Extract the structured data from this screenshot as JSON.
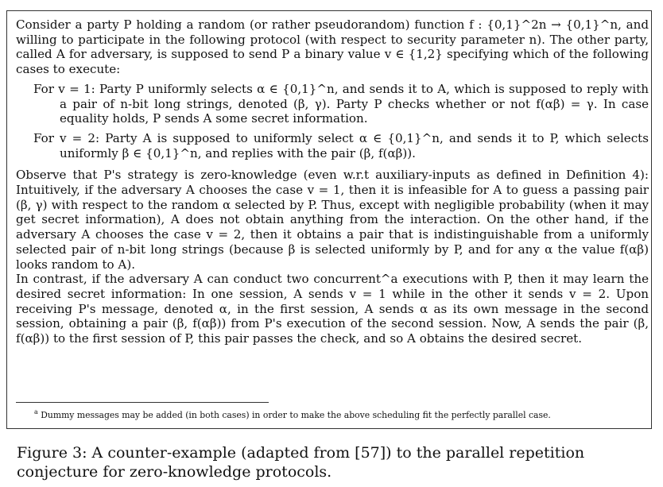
{
  "intro": "Consider a party P holding a random (or rather pseudorandom) function f : {0,1}^2n → {0,1}^n, and willing to participate in the following protocol (with respect to security parameter n). The other party, called A for adversary, is supposed to send P a binary value v ∈ {1,2} specifying which of the following cases to execute:",
  "case1": "For v = 1: Party P uniformly selects α ∈ {0,1}^n, and sends it to A, which is supposed to reply with a pair of n-bit long strings, denoted (β, γ). Party P checks whether or not f(αβ) = γ. In case equality holds, P sends A some secret information.",
  "case2": "For v = 2: Party A is supposed to uniformly select α ∈ {0,1}^n, and sends it to P, which selects uniformly β ∈ {0,1}^n, and replies with the pair (β, f(αβ)).",
  "observe": "Observe that P's strategy is zero-knowledge (even w.r.t auxiliary-inputs as defined in Definition 4): Intuitively, if the adversary A chooses the case v = 1, then it is infeasible for A to guess a passing pair (β, γ) with respect to the random α selected by P. Thus, except with negligible probability (when it may get secret information), A does not obtain anything from the interaction. On the other hand, if the adversary A chooses the case v = 2, then it obtains a pair that is indistinguishable from a uniformly selected pair of n-bit long strings (because β is selected uniformly by P, and for any α the value f(αβ) looks random to A).",
  "contrast": "In contrast, if the adversary A can conduct two concurrent^a executions with P, then it may learn the desired secret information: In one session, A sends v = 1 while in the other it sends v = 2. Upon receiving P's message, denoted α, in the first session, A sends α as its own message in the second session, obtaining a pair (β, f(αβ)) from P's execution of the second session. Now, A sends the pair (β, f(αβ)) to the first session of P, this pair passes the check, and so A obtains the desired secret.",
  "footnote": {
    "mark": "a",
    "text": "Dummy messages may be added (in both cases) in order to make the above scheduling fit the perfectly parallel case."
  },
  "caption": "Figure 3: A counter-example (adapted from [57]) to the parallel repetition conjecture for zero-knowledge protocols."
}
